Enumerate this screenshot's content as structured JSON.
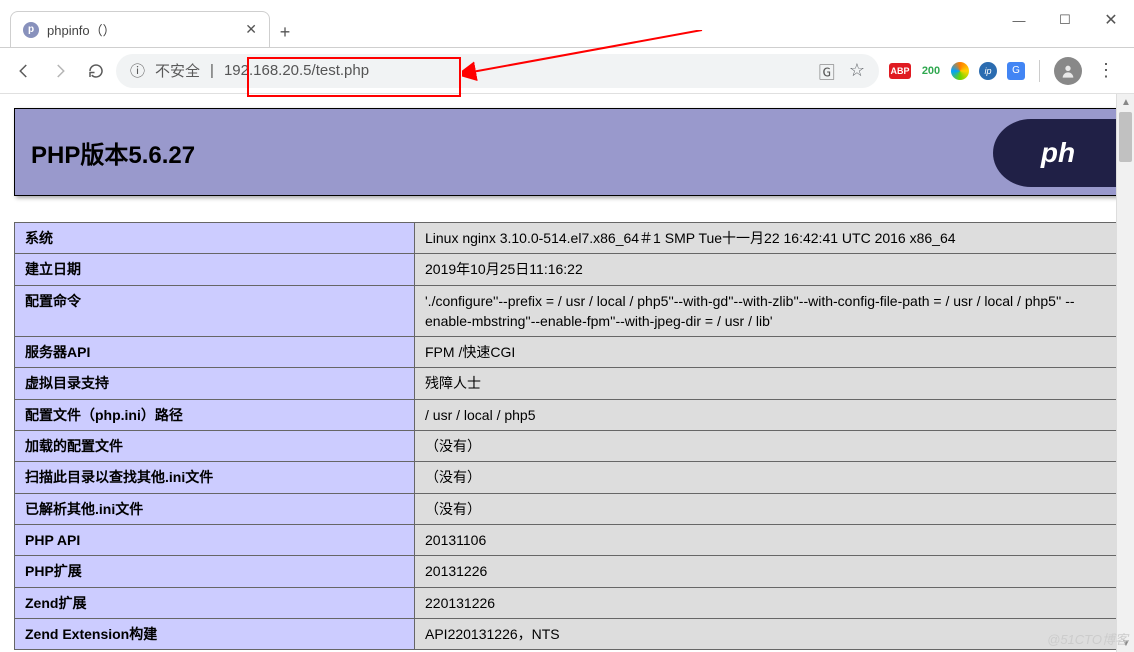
{
  "window": {
    "tab_title": "phpinfo（）",
    "new_tab_label": "+",
    "minimize": "—",
    "maximize": "☐",
    "close": "✕"
  },
  "toolbar": {
    "insecure_label": "不安全",
    "url": "192.168.20.5/test.php",
    "abp_label": "ABP",
    "n200_label": "200",
    "ip_label": "ip",
    "gt_label": "G"
  },
  "php": {
    "banner_title": "PHP版本5.6.27",
    "logo_text": "ph",
    "rows": [
      {
        "k": "系统",
        "v": "Linux nginx 3.10.0-514.el7.x86_64＃1 SMP Tue十一月22 16:42:41 UTC 2016 x86_64"
      },
      {
        "k": "建立日期",
        "v": "2019年10月25日11:16:22"
      },
      {
        "k": "配置命令",
        "v": "'./configure''--prefix = / usr / local / php5''--with-gd''--with-zlib''--with-config-file-path = / usr / local / php5'' --enable-mbstring''--enable-fpm''--with-jpeg-dir = / usr / lib'"
      },
      {
        "k": "服务器API",
        "v": "FPM /快速CGI"
      },
      {
        "k": "虚拟目录支持",
        "v": "残障人士"
      },
      {
        "k": "配置文件（php.ini）路径",
        "v": "/ usr / local / php5"
      },
      {
        "k": "加载的配置文件",
        "v": "（没有）"
      },
      {
        "k": "扫描此目录以查找其他.ini文件",
        "v": "（没有）"
      },
      {
        "k": "已解析其他.ini文件",
        "v": "（没有）"
      },
      {
        "k": "PHP API",
        "v": "20131106"
      },
      {
        "k": "PHP扩展",
        "v": "20131226"
      },
      {
        "k": "Zend扩展",
        "v": "220131226"
      },
      {
        "k": "Zend Extension构建",
        "v": "API220131226，NTS"
      }
    ]
  },
  "watermark": "@51CTO博客"
}
